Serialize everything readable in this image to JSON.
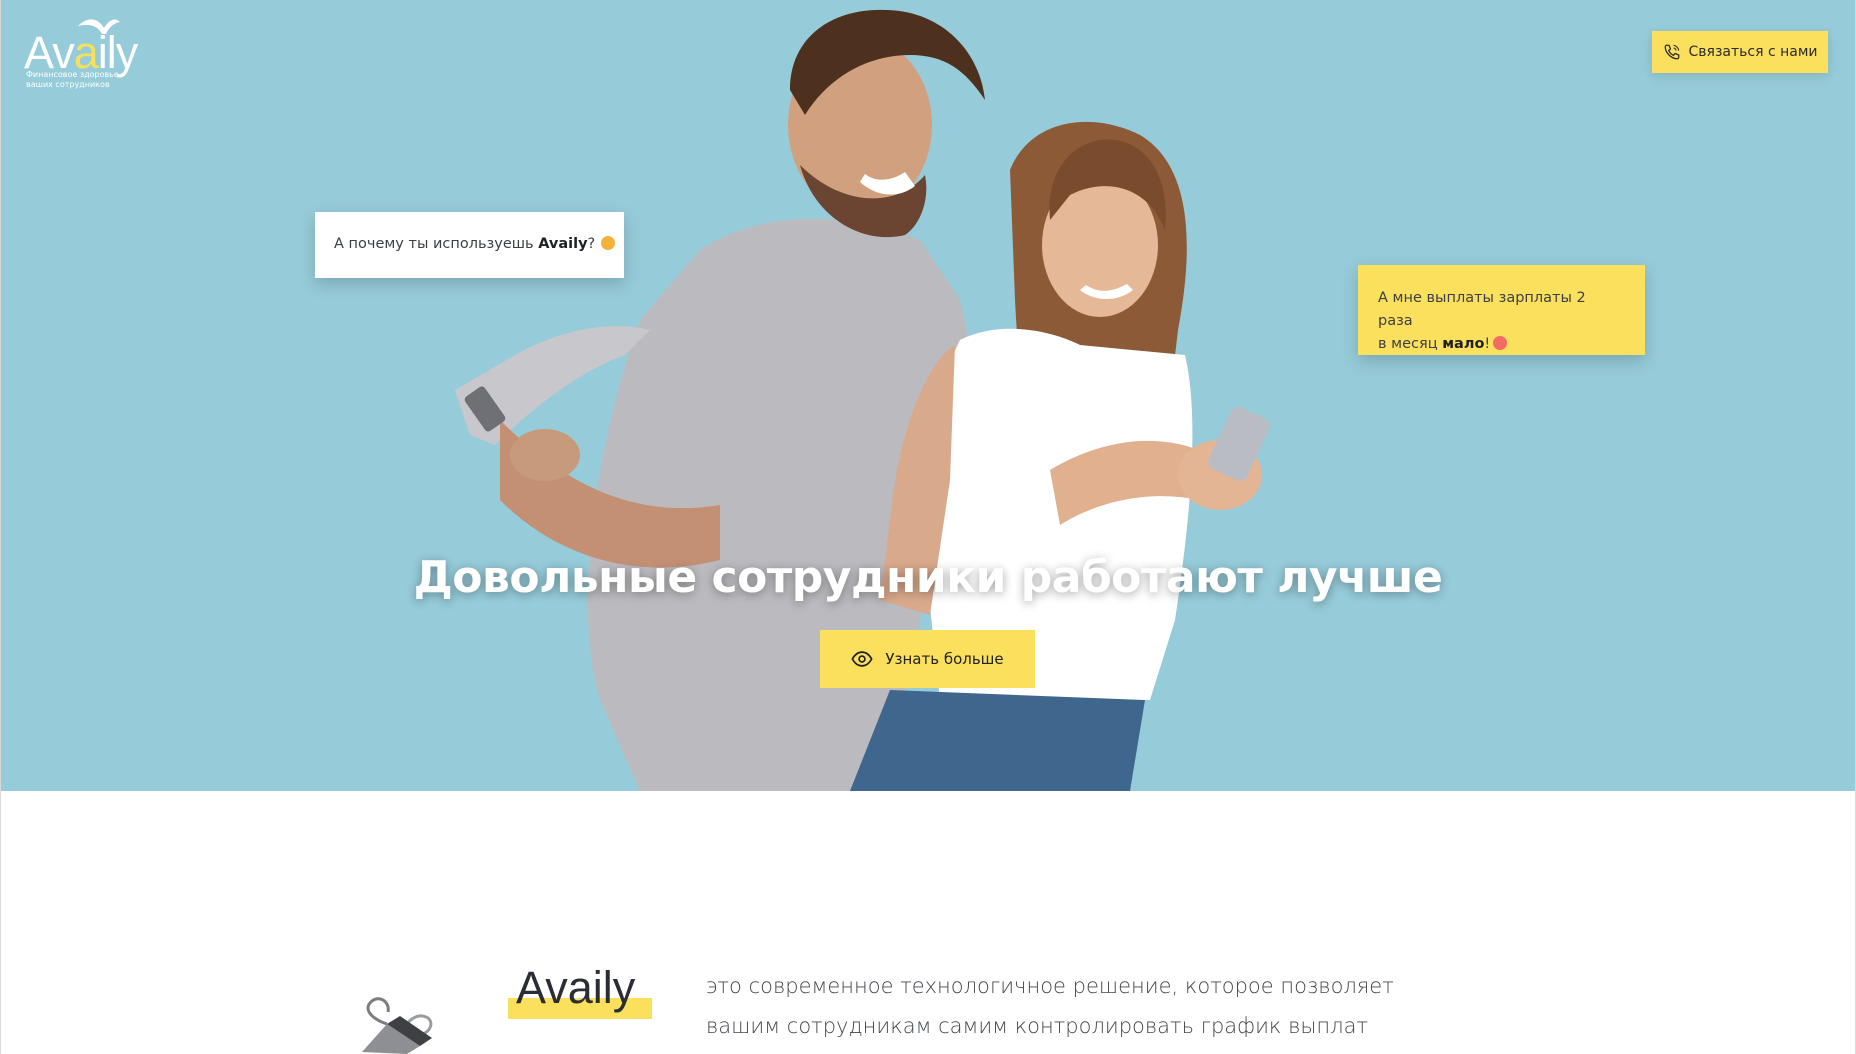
{
  "header": {
    "logo": {
      "word_prefix": "Av",
      "word_accent": "a",
      "word_suffix": "ily",
      "tagline_line1": "Финансовое здоровье",
      "tagline_line2": "ваших сотрудников"
    },
    "contact_button_label": "Связаться с нами",
    "contact_icon": "phone-icon"
  },
  "hero": {
    "bubble_left": {
      "text_before": "А почему ты используешь ",
      "brand": "Availy",
      "text_after": "?",
      "emoji": "thinking-emoji"
    },
    "bubble_right": {
      "text_line1": "А мне выплаты зарплаты 2 раза",
      "text_before": "в месяц ",
      "emphasis": "мало",
      "text_after": "!",
      "emoji": "tongue-emoji"
    },
    "title": "Довольные сотрудники работают лучше",
    "more_button_label": "Узнать больше",
    "more_icon": "eye-icon"
  },
  "about": {
    "brand": "Availy",
    "description_line1": "это современное технологичное решение, которое позволяет",
    "description_line2": "вашим сотрудникам самим контролировать график выплат"
  },
  "colors": {
    "hero_bg": "#96cbd9",
    "accent_yellow": "#fbe05e",
    "text_dark": "#2f3136"
  }
}
